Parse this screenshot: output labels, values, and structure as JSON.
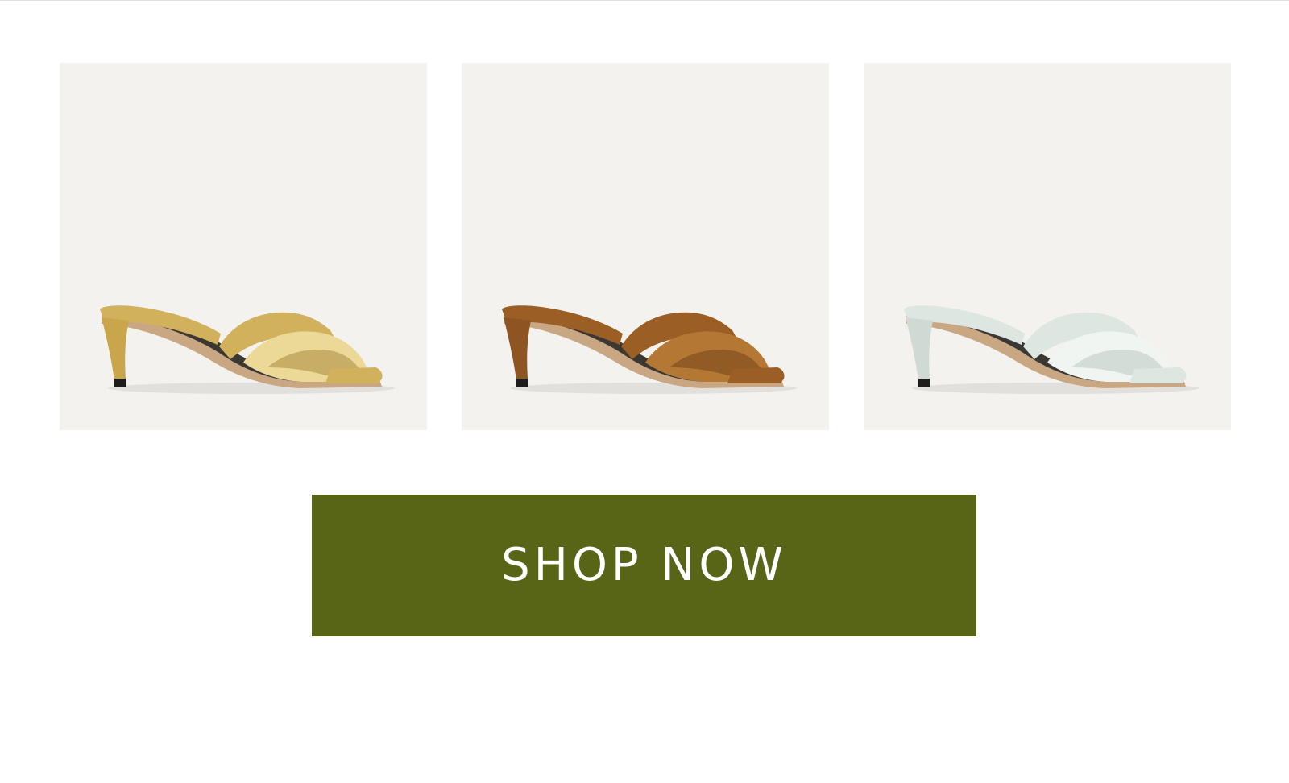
{
  "products": [
    {
      "name": "gold-metallic-heeled-sandal",
      "color": "#d1b15c",
      "shade": "#a98a3c",
      "highlight": "#ecd897",
      "heel": "#c9a64c"
    },
    {
      "name": "brown-suede-heeled-sandal",
      "color": "#9b5e25",
      "shade": "#74431a",
      "highlight": "#b47834",
      "heel": "#8e5422"
    },
    {
      "name": "mint-leather-heeled-sandal",
      "color": "#dde6e1",
      "shade": "#b9c6bf",
      "highlight": "#f1f5f2",
      "heel": "#cfdad4"
    }
  ],
  "tile_background": "#f4f2ee",
  "cta": {
    "label": "SHOP NOW",
    "background": "#586516",
    "text_color": "#ffffff"
  }
}
